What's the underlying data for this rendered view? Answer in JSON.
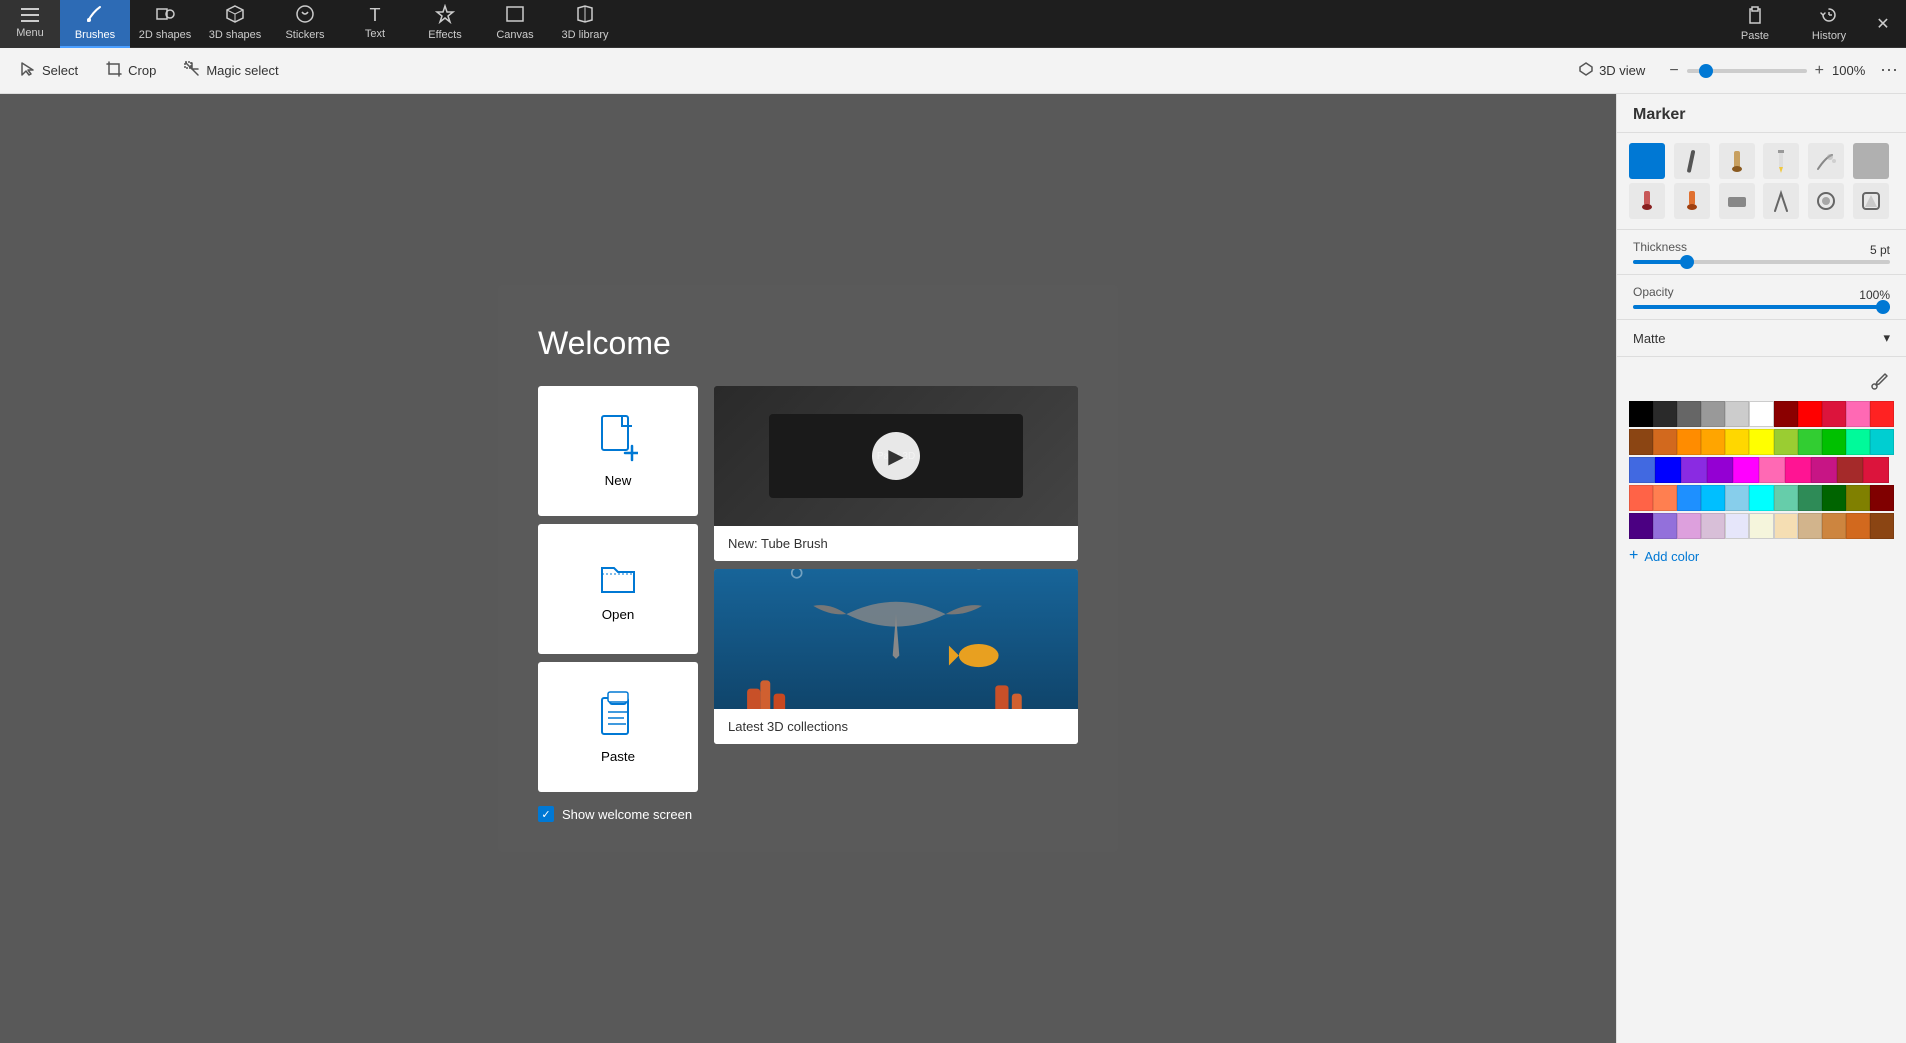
{
  "topToolbar": {
    "menu": {
      "label": "Menu",
      "icon": "☰"
    },
    "tools": [
      {
        "id": "brushes",
        "label": "Brushes",
        "icon": "✏️",
        "active": true
      },
      {
        "id": "2dshapes",
        "label": "2D shapes",
        "icon": "⬡"
      },
      {
        "id": "3dshapes",
        "label": "3D shapes",
        "icon": "⬡"
      },
      {
        "id": "stickers",
        "label": "Stickers",
        "icon": "⚙️"
      },
      {
        "id": "text",
        "label": "Text",
        "icon": "T"
      },
      {
        "id": "effects",
        "label": "Effects",
        "icon": "✦"
      },
      {
        "id": "canvas",
        "label": "Canvas",
        "icon": "▭"
      },
      {
        "id": "3dlibrary",
        "label": "3D library",
        "icon": "📚"
      }
    ],
    "paste": {
      "label": "Paste",
      "icon": "📋"
    },
    "history": {
      "label": "History",
      "icon": "↩"
    },
    "closeBtn": "✕"
  },
  "secondaryToolbar": {
    "select": {
      "label": "Select",
      "icon": "↖"
    },
    "crop": {
      "label": "Crop",
      "icon": "⊡"
    },
    "magicSelect": {
      "label": "Magic select",
      "icon": "⬡"
    },
    "view3d": {
      "label": "3D view",
      "icon": "▷"
    },
    "zoomOut": "−",
    "zoomIn": "+",
    "zoomLevel": "100%",
    "more": "⋯"
  },
  "welcome": {
    "title": "Welcome",
    "actions": [
      {
        "id": "new",
        "label": "New",
        "icon": "📄+"
      },
      {
        "id": "open",
        "label": "Open",
        "icon": "📁"
      },
      {
        "id": "paste",
        "label": "Paste",
        "icon": "📋"
      }
    ],
    "features": [
      {
        "id": "tube-brush",
        "label": "New: Tube Brush",
        "hasVideo": true
      },
      {
        "id": "3d-collections",
        "label": "Latest 3D collections",
        "hasVideo": false
      }
    ],
    "showWelcome": {
      "label": "Show welcome screen",
      "checked": true
    }
  },
  "rightPanel": {
    "title": "Marker",
    "brushes": [
      {
        "id": "marker",
        "active": true,
        "color": "#0078d4"
      },
      {
        "id": "calligraphy",
        "active": false
      },
      {
        "id": "oil",
        "active": false
      },
      {
        "id": "pencil",
        "active": false
      },
      {
        "id": "small",
        "active": false
      },
      {
        "id": "gray",
        "active": false
      },
      {
        "id": "watercolor",
        "active": false
      },
      {
        "id": "orange",
        "active": false
      },
      {
        "id": "wide",
        "active": false
      },
      {
        "id": "b1",
        "active": false
      },
      {
        "id": "b2",
        "active": false
      },
      {
        "id": "b3",
        "active": false
      }
    ],
    "thickness": {
      "label": "Thickness",
      "value": "5 pt",
      "sliderVal": 20
    },
    "opacity": {
      "label": "Opacity",
      "value": "100%",
      "sliderVal": 100
    },
    "matte": {
      "label": "Matte",
      "dropdown": "▾"
    },
    "eyedropper": "💉",
    "colors": {
      "row1": [
        "#000000",
        "#1e1e1e",
        "#444444",
        "#666666",
        "#888888",
        "#aaaaaa",
        "#cccccc",
        "#eeeeee",
        "#ffffff",
        "#ff0000",
        "#ff4444"
      ],
      "row2": [
        "#8b4513",
        "#d2691e",
        "#ff8c00",
        "#ffa500",
        "#ffd700",
        "#ffff00",
        "#9acd32",
        "#32cd32",
        "#00ff00",
        "#00fa9a",
        "#00ced1"
      ],
      "row3": [
        "#4169e1",
        "#0000ff",
        "#8a2be2",
        "#9400d3",
        "#ff00ff",
        "#ff69b4",
        "#ff1493",
        "#c71585",
        "#a52a2a",
        "#dc143c"
      ],
      "row4": [
        "#ff6347",
        "#ff7f50",
        "#1e90ff",
        "#00bfff",
        "#87ceeb"
      ]
    },
    "addColor": {
      "label": "Add color",
      "icon": "+"
    }
  }
}
